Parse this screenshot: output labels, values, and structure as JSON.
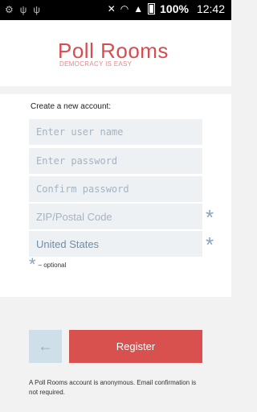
{
  "status_bar": {
    "notification_icons": [
      "usb-icon",
      "usb-icon",
      "usb-icon"
    ],
    "battery_percent": "100%",
    "time": "12:42"
  },
  "header": {
    "title": "Poll Rooms",
    "subtitle": "DEMOCRACY IS EASY"
  },
  "form": {
    "title": "Create a new account:",
    "username_placeholder": "Enter user name",
    "password_placeholder": "Enter password",
    "confirm_placeholder": "Confirm password",
    "zip_placeholder": "ZIP/Postal Code",
    "country_value": "United States",
    "optional_marker": "*",
    "optional_legend": "– optional"
  },
  "actions": {
    "back_glyph": "←",
    "register_label": "Register"
  },
  "footnote": "A Poll Rooms account is anonymous. Email confirmation is not required.",
  "colors": {
    "brand": "#d94c4e",
    "register_button": "#d9514f",
    "field_bg": "#eef1f4",
    "marker": "#8ba3bb"
  }
}
